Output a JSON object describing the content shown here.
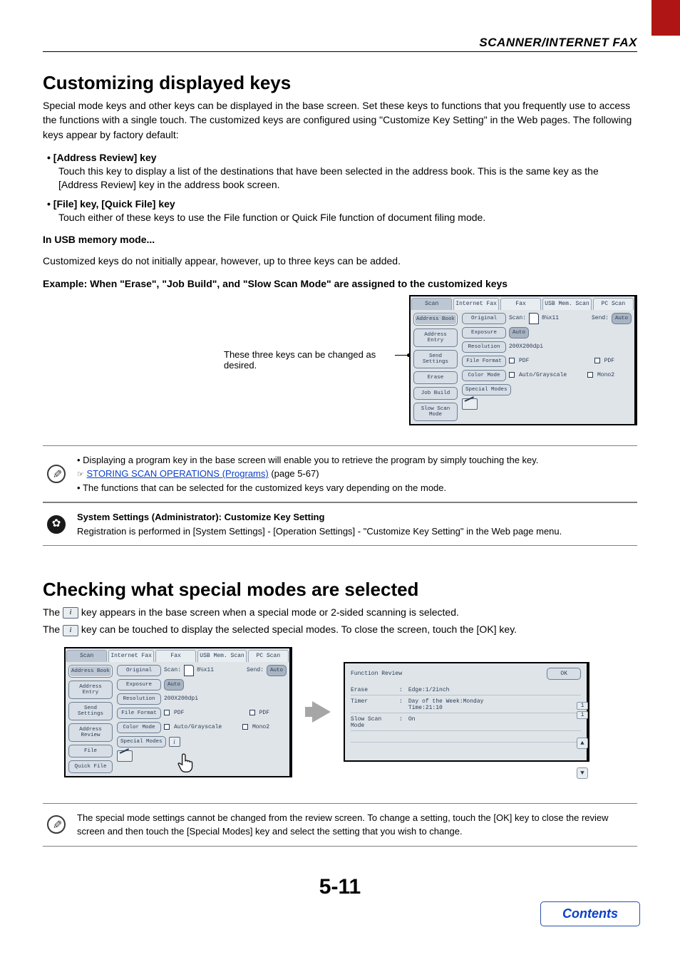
{
  "header": {
    "title": "SCANNER/INTERNET FAX"
  },
  "section1": {
    "heading": "Customizing displayed keys",
    "para": "Special mode keys and other keys can be displayed in the base screen. Set these keys to functions that you frequently use to access the functions with a single touch. The customized keys are configured using \"Customize Key Setting\" in the Web pages. The following keys appear by factory default:",
    "b1_head": "• [Address Review] key",
    "b1_body": "Touch this key to display a list of the destinations that have been selected in the address book. This is the same key as the [Address Review] key in the address book screen.",
    "b2_head": "• [File] key, [Quick File] key",
    "b2_body": "Touch either of these keys to use the File function or Quick File function of document filing mode.",
    "usb_head": "In USB memory mode...",
    "usb_body": "Customized keys do not initially appear, however, up to three keys can be added.",
    "example_head": "Example: When \"Erase\", \"Job Build\", and \"Slow Scan Mode\" are assigned to the customized keys",
    "caption": "These three keys can be changed as desired."
  },
  "note1": {
    "line1": "Displaying a program key in the base screen will enable you to retrieve the program by simply touching the key.",
    "link_icon": "☞",
    "link_text": "STORING SCAN OPERATIONS (Programs)",
    "link_page": " (page 5-67)",
    "line2": "The functions that can be selected for the customized keys vary depending on the mode."
  },
  "note2": {
    "title": "System Settings (Administrator): Customize Key Setting",
    "body": "Registration is performed in [System Settings] - [Operation Settings] - \"Customize Key Setting\" in the Web page menu."
  },
  "section2": {
    "heading": "Checking what special modes are selected",
    "line1a": "The ",
    "line1b": " key appears in the base screen when a special mode or 2-sided scanning is selected.",
    "line2a": "The ",
    "line2b": " key can be touched to display the selected special modes. To close the screen, touch the [OK] key."
  },
  "note3": {
    "body": "The special mode settings cannot be changed from the review screen. To change a setting, touch the [OK] key to close the review screen and then touch the [Special Modes] key and select the setting that you wish to change."
  },
  "pagenum": "5-11",
  "contents_label": "Contents",
  "screenA": {
    "tabs": [
      "Scan",
      "Internet Fax",
      "Fax",
      "USB Mem. Scan",
      "PC Scan"
    ],
    "active_tab": 0,
    "side": [
      "Address Book",
      "Address Entry",
      "Send Settings",
      "Erase",
      "Job Build",
      "Slow Scan Mode"
    ],
    "rows": {
      "original": {
        "label": "Original",
        "scan_label": "Scan:",
        "scan_val": "8½x11",
        "send_label": "Send:",
        "send_val": "Auto"
      },
      "exposure": {
        "label": "Exposure",
        "val": "Auto"
      },
      "resolution": {
        "label": "Resolution",
        "val": "200X200dpi"
      },
      "fileformat": {
        "label": "File Format",
        "v1": "PDF",
        "v2": "PDF"
      },
      "colormode": {
        "label": "Color Mode",
        "v1": "Auto/Grayscale",
        "v2": "Mono2"
      },
      "special": {
        "label": "Special Modes"
      }
    }
  },
  "screenB": {
    "tabs": [
      "Scan",
      "Internet Fax",
      "Fax",
      "USB Mem. Scan",
      "PC Scan"
    ],
    "active_tab": 0,
    "side": [
      "Address Book",
      "Address Entry",
      "Send Settings",
      "Address Review",
      "File",
      "Quick File"
    ],
    "rows": {
      "original": {
        "label": "Original",
        "scan_label": "Scan:",
        "scan_val": "8½x11",
        "send_label": "Send:",
        "send_val": "Auto"
      },
      "exposure": {
        "label": "Exposure",
        "val": "Auto"
      },
      "resolution": {
        "label": "Resolution",
        "val": "200X200dpi"
      },
      "fileformat": {
        "label": "File Format",
        "v1": "PDF",
        "v2": "PDF"
      },
      "colormode": {
        "label": "Color Mode",
        "v1": "Auto/Grayscale",
        "v2": "Mono2"
      },
      "special": {
        "label": "Special Modes"
      }
    }
  },
  "fr": {
    "title": "Function Review",
    "ok": "OK",
    "rows": [
      {
        "label": "Erase",
        "value": "Edge:1/2inch"
      },
      {
        "label": "Timer",
        "value": "Day of the Week:Monday\nTime:21:10"
      },
      {
        "label": "Slow Scan Mode",
        "value": "On"
      }
    ],
    "page_current": "1",
    "page_total": "1"
  }
}
